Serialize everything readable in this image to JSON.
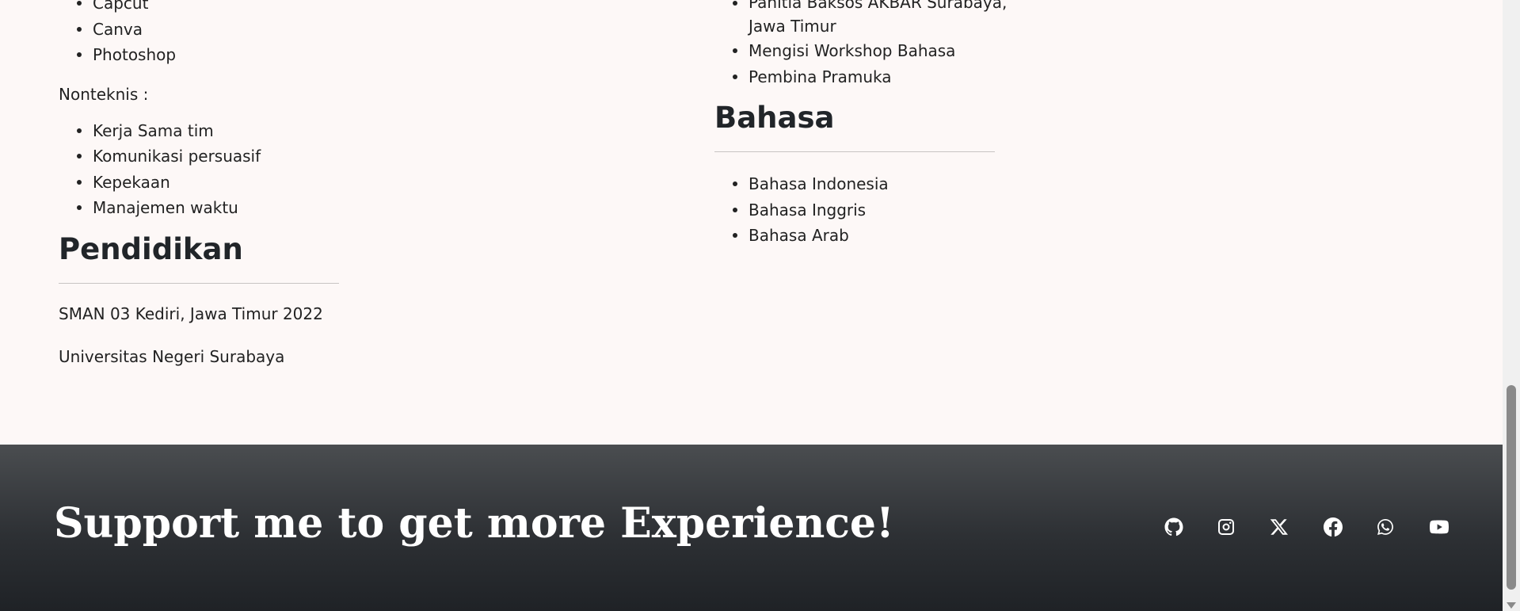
{
  "left_column": {
    "tech_skills": [
      "Capcut",
      "Canva",
      "Photoshop"
    ],
    "nontech_label": "Nonteknis :",
    "nontech_skills": [
      "Kerja Sama tim",
      "Komunikasi persuasif",
      "Kepekaan",
      "Manajemen waktu"
    ],
    "education_title": "Pendidikan",
    "education": [
      "SMAN 03 Kediri, Jawa Timur 2022",
      "Universitas Negeri Surabaya"
    ]
  },
  "right_column": {
    "experience_partial": [
      "Panitia Baksos AKBAR Surabaya,",
      "Jawa Timur"
    ],
    "experience_items": [
      "Mengisi Workshop Bahasa",
      "Pembina Pramuka"
    ],
    "language_title": "Bahasa",
    "languages": [
      "Bahasa Indonesia",
      "Bahasa Inggris",
      "Bahasa Arab"
    ]
  },
  "footer": {
    "title": "Support me to get more Experience!",
    "social_icons": [
      "github-icon",
      "instagram-icon",
      "x-twitter-icon",
      "facebook-icon",
      "whatsapp-icon",
      "youtube-icon"
    ],
    "icon_color": "#ffffff"
  }
}
